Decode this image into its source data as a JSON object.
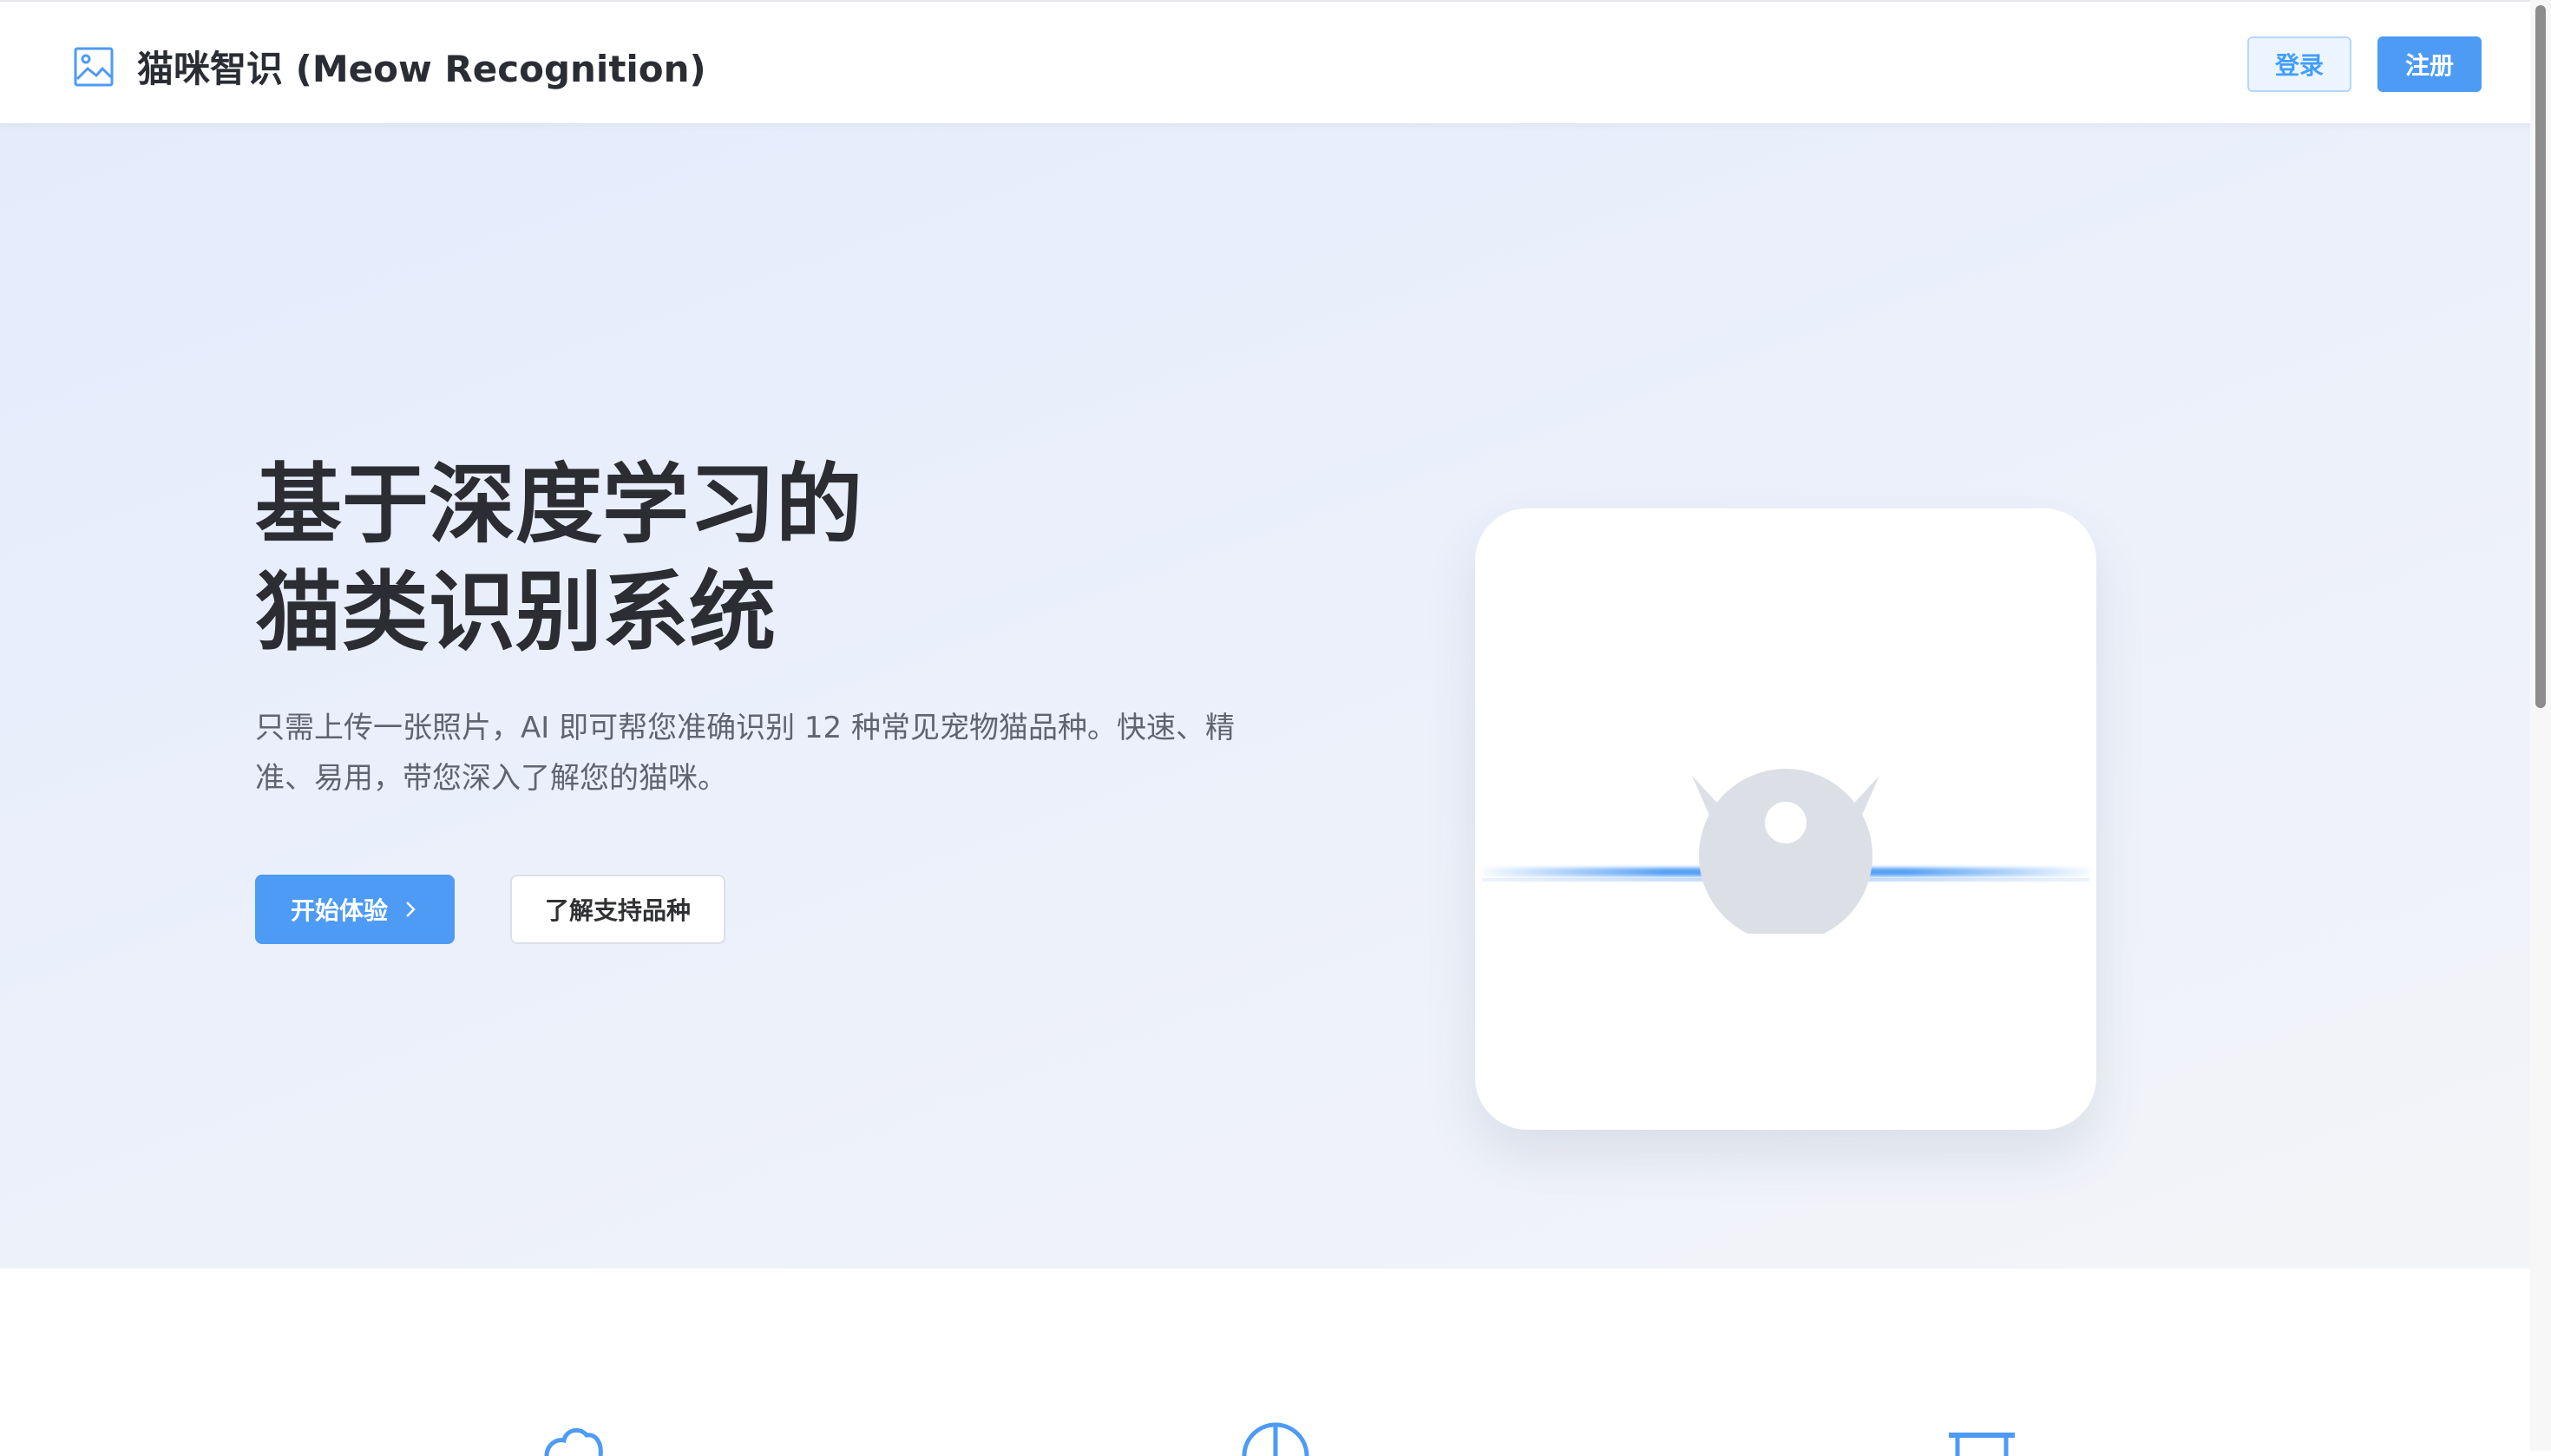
{
  "header": {
    "title": "猫咪智识 (Meow Recognition)",
    "logo_icon": "image-icon",
    "login_label": "登录",
    "register_label": "注册"
  },
  "hero": {
    "title_line1": "基于深度学习的",
    "title_line2": "猫类识别系统",
    "description": "只需上传一张照片，AI 即可帮您准确识别 12 种常见宠物猫品种。快速、精准、易用，带您深入了解您的猫咪。",
    "start_label": "开始体验",
    "breeds_label": "了解支持品种",
    "illustration_icon": "cat-icon"
  },
  "features": {
    "icons": [
      "upload-cloud-icon",
      "pie-chart-icon",
      "hourglass-icon"
    ]
  },
  "colors": {
    "primary": "#4d9bf5",
    "text": "#2b2d33",
    "muted": "#5f6470",
    "icon_gray": "#dcdfe6"
  }
}
